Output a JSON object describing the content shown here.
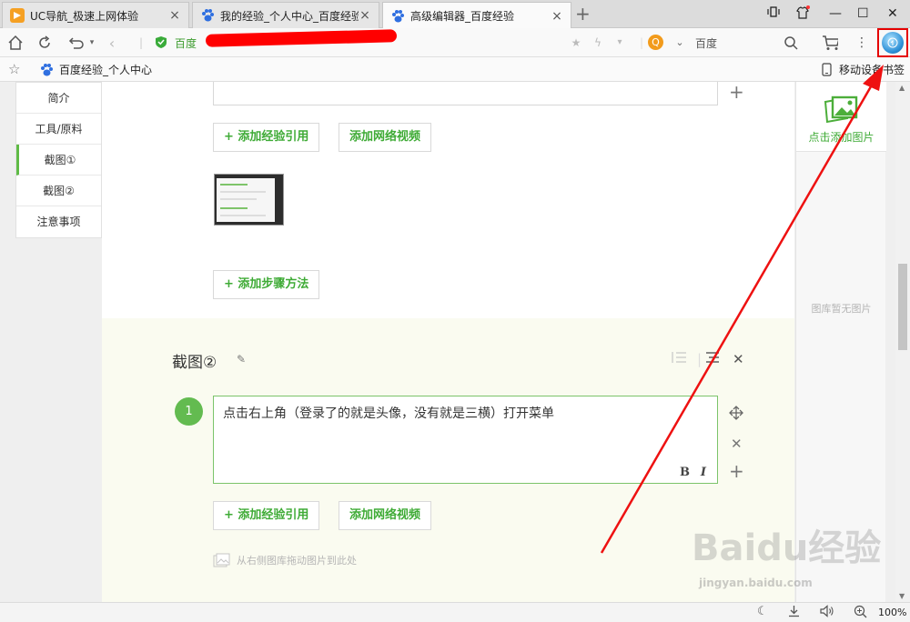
{
  "tabs": [
    {
      "title": "UC导航_极速上网体验",
      "active": false
    },
    {
      "title": "我的经验_个人中心_百度经验",
      "active": false
    },
    {
      "title": "高级编辑器_百度经验",
      "active": true
    }
  ],
  "address": {
    "site_name": "百度",
    "search_placeholder": "百度"
  },
  "bookmarks": {
    "item": "百度经验_个人中心",
    "mobile": "移动设备书签"
  },
  "left_nav": [
    "简介",
    "工具/原料",
    "截图①",
    "截图②",
    "注意事项"
  ],
  "left_nav_active": "截图①",
  "section1": {
    "btn_ref": "+ 添加经验引用",
    "btn_video": "添加网络视频",
    "btn_add_step": "+ 添加步骤方法"
  },
  "section2": {
    "title": "截图②",
    "step_number": "1",
    "step_text": "点击右上角（登录了的就是头像，没有就是三横）打开菜单",
    "bold_label": "B",
    "italic_label": "I",
    "btn_ref": "+ 添加经验引用",
    "btn_video": "添加网络视频",
    "drag_hint": "从右侧图库拖动图片到此处"
  },
  "right_panel": {
    "add_image": "点击添加图片",
    "empty": "图库暂无图片"
  },
  "watermark": {
    "brand": "Baidu经验",
    "url": "jingyan.baidu.com"
  },
  "status": {
    "zoom": "100%"
  },
  "colors": {
    "accent_green": "#3fab36",
    "highlight_red": "#e50000"
  }
}
